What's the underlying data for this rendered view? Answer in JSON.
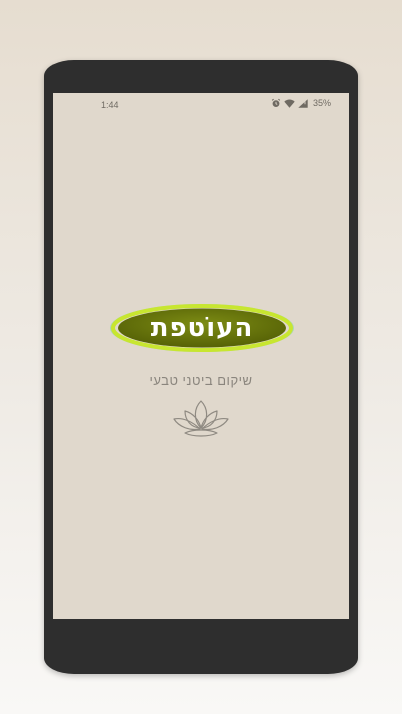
{
  "status_bar": {
    "time": "1:44",
    "battery_text": "35%",
    "icons": [
      "alarm-icon",
      "wifi-icon",
      "signal-icon"
    ]
  },
  "splash": {
    "logo_text": "העוֹטפת",
    "tagline": "שיקום ביטני טבעי",
    "emblem": "lotus-icon"
  },
  "colors": {
    "screen_background": "#e0d8cc",
    "logo_fill": "#6b7a0c",
    "logo_ring": "#c8e630",
    "phone_frame": "#2e2e2e",
    "text_muted": "#8a857d"
  }
}
